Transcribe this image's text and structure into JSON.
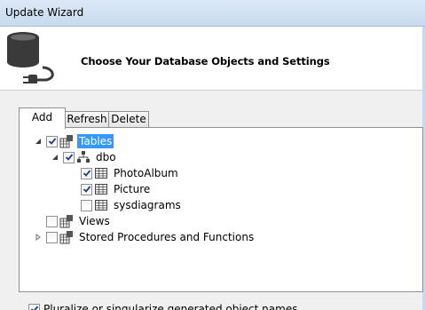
{
  "window": {
    "title": "Update Wizard"
  },
  "header": {
    "heading": "Choose Your Database Objects and Settings"
  },
  "tabs": [
    {
      "label": "Add",
      "active": true
    },
    {
      "label": "Refresh",
      "active": false
    },
    {
      "label": "Delete",
      "active": false
    }
  ],
  "tree": {
    "tables": {
      "label": "Tables",
      "checked": true,
      "expanded": true,
      "selected": true
    },
    "dbo": {
      "label": "dbo",
      "checked": true,
      "expanded": true
    },
    "items": [
      {
        "label": "PhotoAlbum",
        "checked": true
      },
      {
        "label": "Picture",
        "checked": true
      },
      {
        "label": "sysdiagrams",
        "checked": false
      }
    ],
    "views": {
      "label": "Views",
      "checked": false
    },
    "procs": {
      "label": "Stored Procedures and Functions",
      "checked": false,
      "expanded": false
    }
  },
  "options": {
    "pluralize_label": "Pluralize or singularize generated object names",
    "pluralize_checked": true
  },
  "colors": {
    "selection": "#3399ff",
    "titlebar": "#c9daef"
  },
  "icons": {
    "header": "database-plug-icon",
    "tables": "tables-folder-icon",
    "schema": "schema-icon",
    "table": "table-grid-icon"
  }
}
